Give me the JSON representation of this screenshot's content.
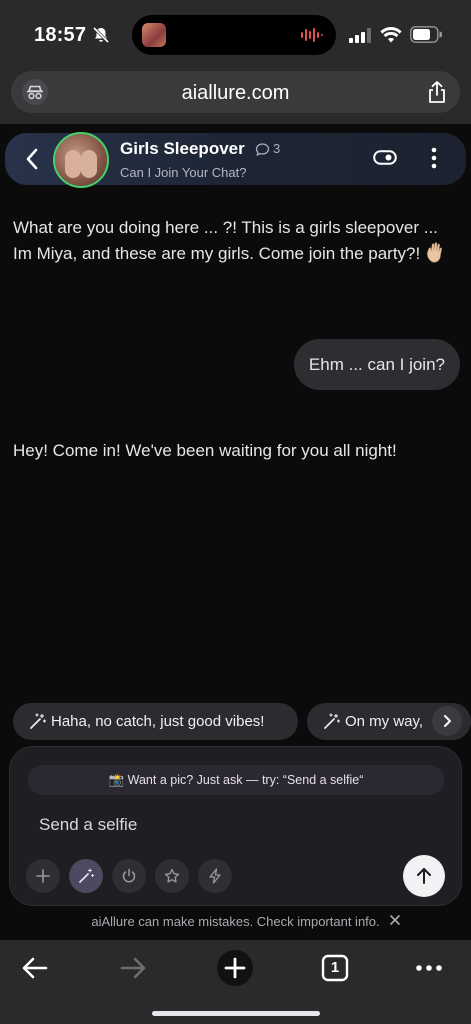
{
  "status_bar": {
    "time": "18:57"
  },
  "browser": {
    "url": "aiallure.com"
  },
  "chat_header": {
    "name": "Girls Sleepover",
    "comment_count": "3",
    "subtitle": "Can I Join Your Chat?"
  },
  "messages": [
    {
      "role": "bot",
      "text": "What are you doing here ... ?! This is a girls sleepover ... Im Miya, and these are my girls. Come join the party?! "
    },
    {
      "role": "user",
      "text": "Ehm ... can I join?"
    },
    {
      "role": "bot",
      "text": "Hey! Come in! We've been waiting for you all night!"
    }
  ],
  "suggestions": [
    {
      "label": "Haha, no catch, just good vibes!"
    },
    {
      "label": "On my way,"
    }
  ],
  "composer": {
    "hint": "📸 Want a pic? Just ask — try: “Send a selfie“",
    "input_value": "Send a selfie"
  },
  "disclaimer": "aiAllure can make mistakes. Check important info.",
  "toolbar": {
    "tab_count": "1"
  },
  "colors": {
    "online_ring": "#45d16a",
    "send_button": "#f2f2f5"
  }
}
